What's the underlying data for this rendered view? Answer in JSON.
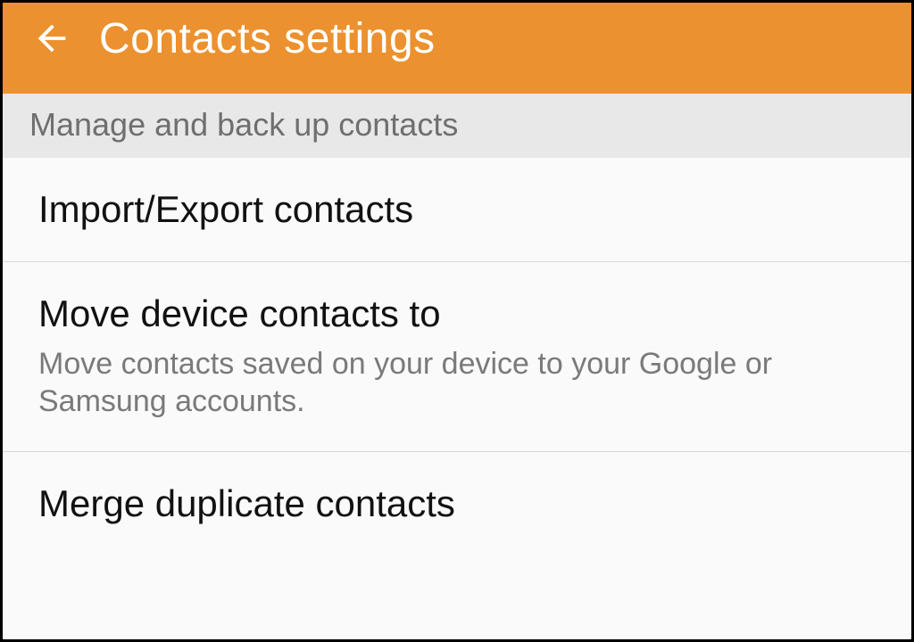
{
  "header": {
    "title": "Contacts settings"
  },
  "section": {
    "label": "Manage and back up contacts"
  },
  "items": [
    {
      "title": "Import/Export contacts",
      "subtitle": null
    },
    {
      "title": "Move device contacts to",
      "subtitle": "Move contacts saved on your device to your Google or Samsung accounts."
    },
    {
      "title": "Merge duplicate contacts",
      "subtitle": null
    }
  ]
}
